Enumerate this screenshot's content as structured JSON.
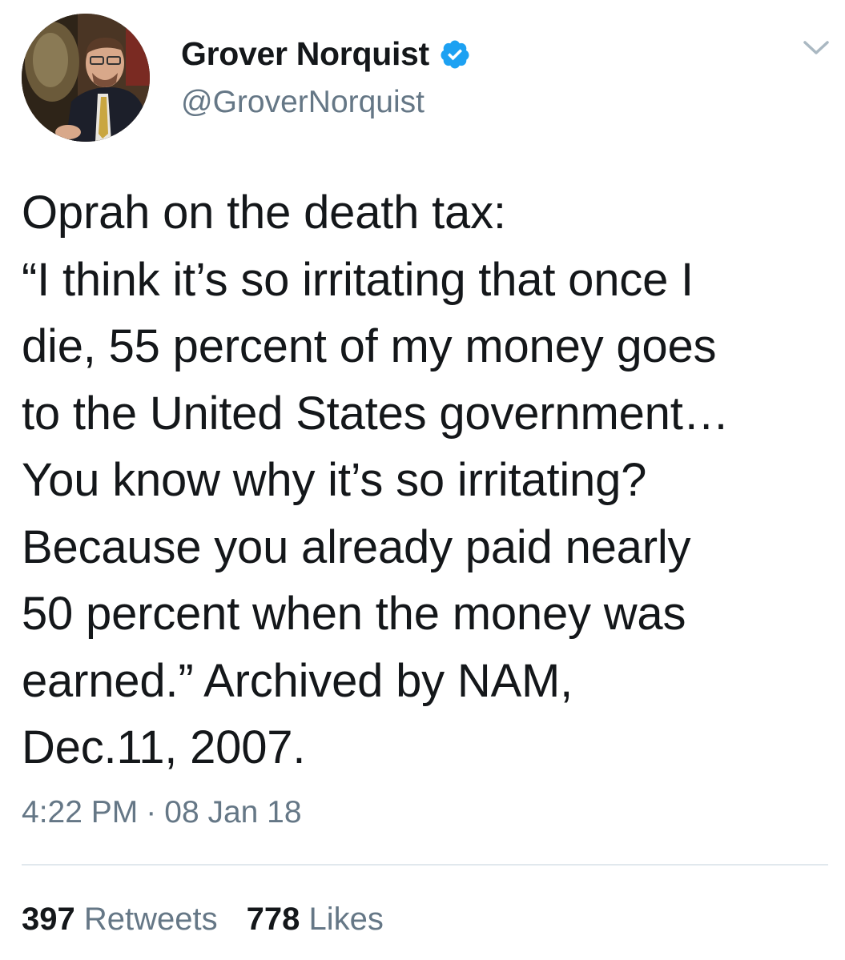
{
  "author": {
    "display_name": "Grover Norquist",
    "handle": "@GroverNorquist",
    "verified": true
  },
  "tweet": {
    "lines": [
      "Oprah on the death tax:",
      "“I think it’s so irritating that once I",
      "die, 55 percent of my money goes",
      "to the United States government…",
      "You know why it’s so irritating?",
      "Because you already paid nearly",
      "50 percent when the money was",
      "earned.” Archived by NAM,",
      "Dec.11, 2007."
    ]
  },
  "meta": {
    "time": "4:22 PM",
    "separator": "·",
    "date": "08 Jan 18"
  },
  "stats": {
    "retweets_count": "397",
    "retweets_label": "Retweets",
    "likes_count": "778",
    "likes_label": "Likes"
  },
  "icons": {
    "verified": "verified-badge-icon",
    "caret": "chevron-down-icon"
  },
  "colors": {
    "verified_blue": "#1da1f2",
    "secondary_text": "#657786",
    "primary_text": "#14171a",
    "divider": "#e1e8ed"
  }
}
